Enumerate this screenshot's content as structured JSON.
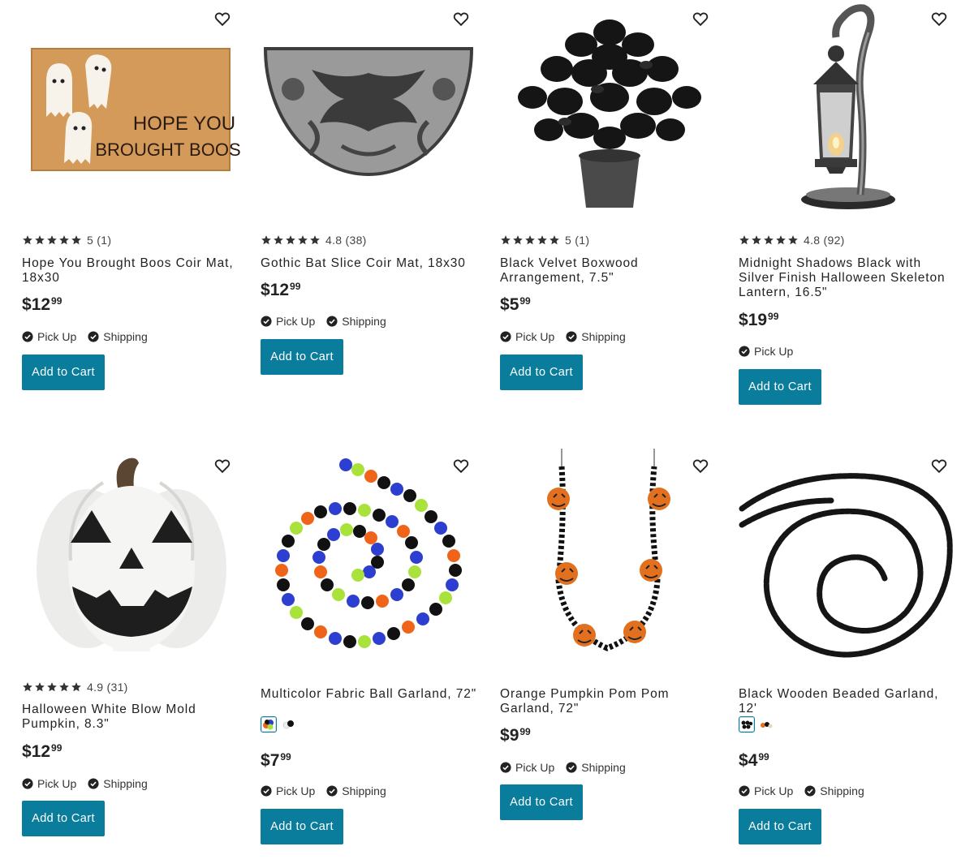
{
  "products": [
    {
      "rating": "5 (1)",
      "title": "Hope You Brought Boos Coir Mat, 18x30",
      "price": {
        "currency": "$",
        "dollars": "12",
        "cents": "99"
      },
      "pickup_label": "Pick Up",
      "shipping_label": "Shipping",
      "add_to_cart": "Add to Cart",
      "image_icon": "doormat-ghosts-icon",
      "mat_text_line1": "HOPE YOU",
      "mat_text_line2": "BROUGHT BOOS"
    },
    {
      "rating": "4.8 (38)",
      "title": "Gothic Bat Slice Coir Mat, 18x30",
      "price": {
        "currency": "$",
        "dollars": "12",
        "cents": "99"
      },
      "pickup_label": "Pick Up",
      "shipping_label": "Shipping",
      "add_to_cart": "Add to Cart",
      "image_icon": "half-round-mat-icon"
    },
    {
      "rating": "5 (1)",
      "title": "Black Velvet Boxwood Arrangement, 7.5\"",
      "price": {
        "currency": "$",
        "dollars": "5",
        "cents": "99"
      },
      "pickup_label": "Pick Up",
      "shipping_label": "Shipping",
      "add_to_cart": "Add to Cart",
      "image_icon": "potted-plant-icon"
    },
    {
      "rating": "4.8 (92)",
      "title": "Midnight Shadows Black with Silver Finish Halloween Skeleton Lantern, 16.5\"",
      "price": {
        "currency": "$",
        "dollars": "19",
        "cents": "99"
      },
      "pickup_label": "Pick Up",
      "add_to_cart": "Add to Cart",
      "image_icon": "skeleton-lantern-icon"
    },
    {
      "rating": "4.9 (31)",
      "title": "Halloween White Blow Mold Pumpkin, 8.3\"",
      "price": {
        "currency": "$",
        "dollars": "12",
        "cents": "99"
      },
      "pickup_label": "Pick Up",
      "shipping_label": "Shipping",
      "add_to_cart": "Add to Cart",
      "image_icon": "white-pumpkin-icon"
    },
    {
      "title": "Multicolor Fabric Ball Garland, 72\"",
      "price": {
        "currency": "$",
        "dollars": "7",
        "cents": "99"
      },
      "pickup_label": "Pick Up",
      "shipping_label": "Shipping",
      "add_to_cart": "Add to Cart",
      "image_icon": "ball-garland-icon"
    },
    {
      "title": "Orange Pumpkin Pom Pom Garland, 72\"",
      "price": {
        "currency": "$",
        "dollars": "9",
        "cents": "99"
      },
      "pickup_label": "Pick Up",
      "shipping_label": "Shipping",
      "add_to_cart": "Add to Cart",
      "image_icon": "pumpkin-garland-icon"
    },
    {
      "title": "Black Wooden Beaded Garland, 12'",
      "price": {
        "currency": "$",
        "dollars": "4",
        "cents": "99"
      },
      "pickup_label": "Pick Up",
      "shipping_label": "Shipping",
      "add_to_cart": "Add to Cart",
      "image_icon": "bead-garland-icon"
    }
  ],
  "colors": {
    "accent": "#0a7d9c",
    "text": "#222222",
    "star": "#333333"
  }
}
